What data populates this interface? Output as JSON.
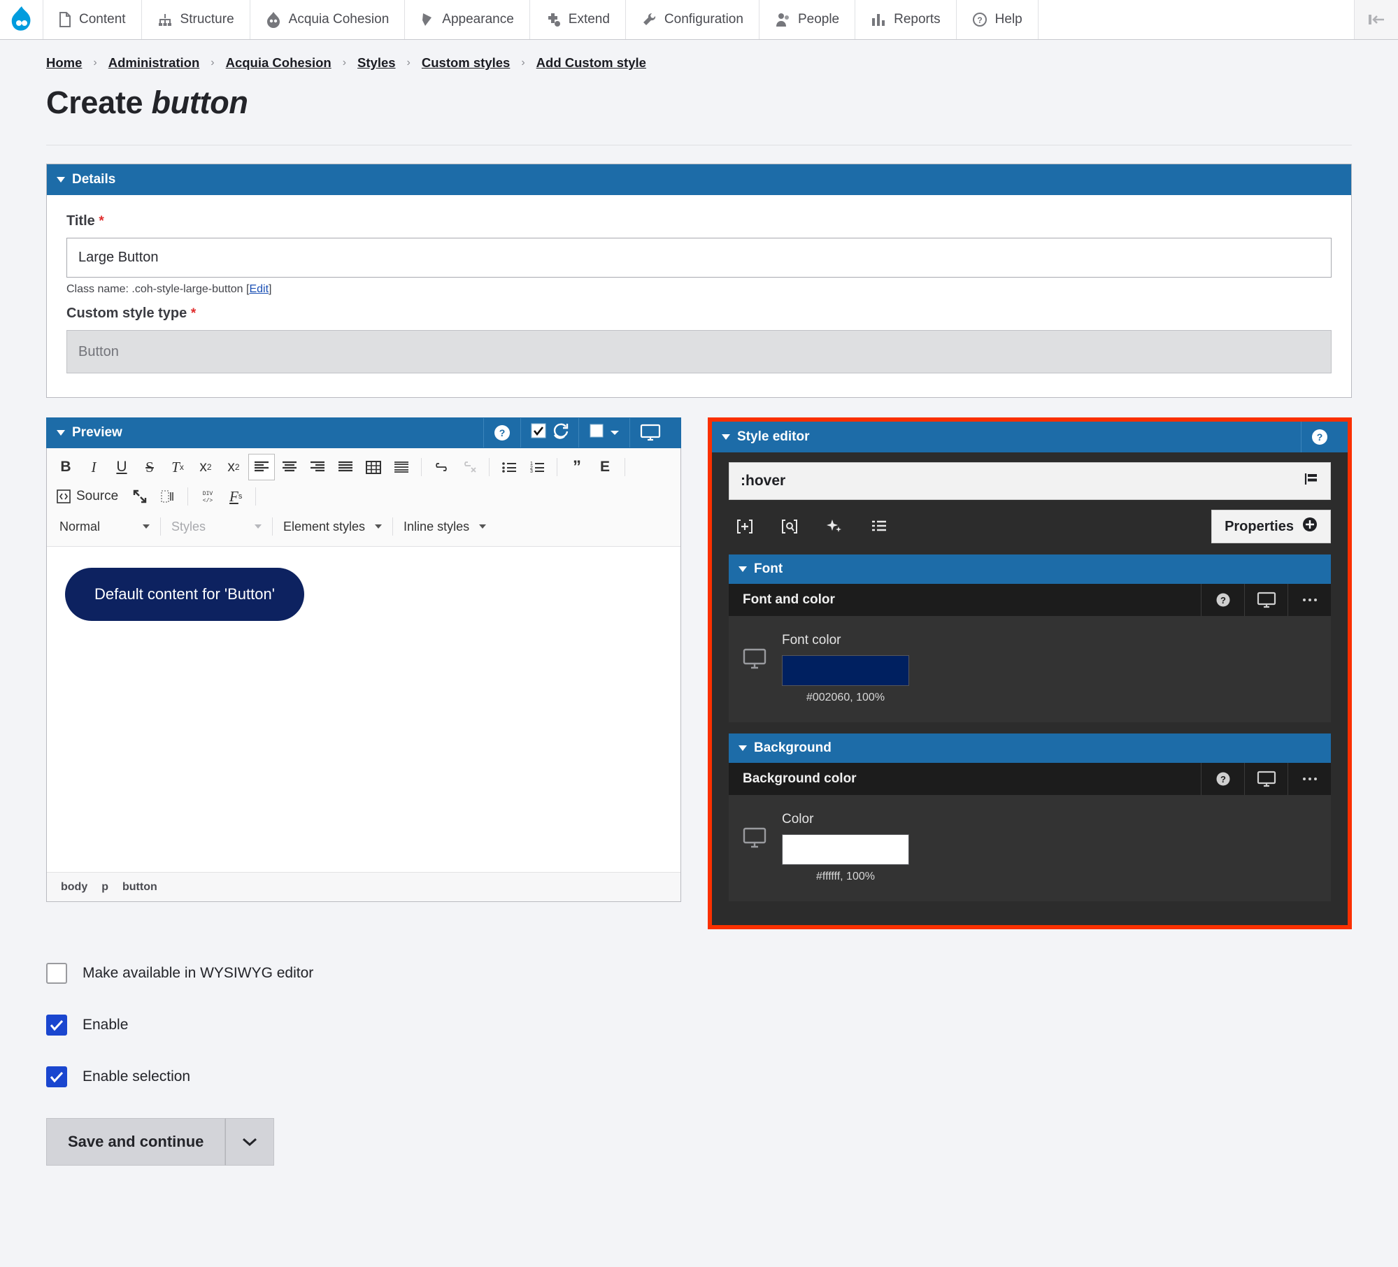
{
  "admin_toolbar": {
    "logo": "drupal-logo",
    "items": [
      {
        "label": "Content",
        "icon": "content-icon"
      },
      {
        "label": "Structure",
        "icon": "structure-icon"
      },
      {
        "label": "Acquia Cohesion",
        "icon": "acquia-cohesion-icon"
      },
      {
        "label": "Appearance",
        "icon": "appearance-icon"
      },
      {
        "label": "Extend",
        "icon": "extend-icon"
      },
      {
        "label": "Configuration",
        "icon": "configuration-icon"
      },
      {
        "label": "People",
        "icon": "people-icon"
      },
      {
        "label": "Reports",
        "icon": "reports-icon"
      },
      {
        "label": "Help",
        "icon": "help-icon"
      }
    ],
    "collapse_icon": "collapse-toolbar-icon"
  },
  "breadcrumb": [
    "Home",
    "Administration",
    "Acquia Cohesion",
    "Styles",
    "Custom styles",
    "Add Custom style"
  ],
  "page": {
    "title_prefix": "Create",
    "title_emphasis": "button"
  },
  "details": {
    "panel_title": "Details",
    "title_label": "Title",
    "title_value": "Large Button",
    "title_placeholder": "Title",
    "required_mark": "*",
    "class_name_text": "Class name: .coh-style-large-button [",
    "class_name_edit": "Edit",
    "class_name_close": "]",
    "custom_style_type_label": "Custom style type",
    "custom_style_type_value": "Button"
  },
  "preview": {
    "panel_title": "Preview",
    "actions": [
      {
        "name": "help-icon",
        "label": "?"
      },
      {
        "name": "validate-checkbox-icon",
        "label": ""
      },
      {
        "name": "refresh-icon",
        "label": ""
      },
      {
        "name": "background-color-swatch",
        "label": ""
      },
      {
        "name": "desktop-breakpoint-icon",
        "label": ""
      }
    ],
    "toolbar_row1": [
      {
        "name": "bold-icon",
        "glyph": "B",
        "state": "normal"
      },
      {
        "name": "italic-icon",
        "glyph": "I",
        "state": "normal"
      },
      {
        "name": "underline-icon",
        "glyph": "U",
        "state": "normal"
      },
      {
        "name": "strikethrough-icon",
        "glyph": "S",
        "state": "normal"
      },
      {
        "name": "remove-format-icon",
        "glyph": "Tx",
        "state": "normal"
      },
      {
        "name": "superscript-icon",
        "glyph": "x2",
        "state": "normal"
      },
      {
        "name": "subscript-icon",
        "glyph": "x2",
        "state": "normal"
      },
      {
        "name": "align-left-icon",
        "glyph": "",
        "state": "active"
      },
      {
        "name": "align-center-icon",
        "glyph": "",
        "state": "normal"
      },
      {
        "name": "align-right-icon",
        "glyph": "",
        "state": "normal"
      },
      {
        "name": "align-justify-icon",
        "glyph": "",
        "state": "normal"
      },
      {
        "name": "table-icon",
        "glyph": "",
        "state": "normal"
      },
      {
        "name": "horizontal-rule-icon",
        "glyph": "",
        "state": "normal"
      },
      {
        "name": "link-icon",
        "glyph": "",
        "state": "normal"
      },
      {
        "name": "unlink-icon",
        "glyph": "",
        "state": "disabled"
      },
      {
        "name": "bulleted-list-icon",
        "glyph": "",
        "state": "normal"
      },
      {
        "name": "numbered-list-icon",
        "glyph": "",
        "state": "normal"
      },
      {
        "name": "blockquote-icon",
        "glyph": "”",
        "state": "normal"
      },
      {
        "name": "entity-icon",
        "glyph": "E",
        "state": "normal"
      }
    ],
    "toolbar_row2": {
      "source_label": "Source",
      "buttons": [
        {
          "name": "maximize-icon"
        },
        {
          "name": "show-blocks-icon"
        },
        {
          "name": "div-container-icon"
        },
        {
          "name": "styles-format-icon"
        }
      ]
    },
    "combos": [
      {
        "name": "paragraph-format-select",
        "value": "Normal",
        "muted": false
      },
      {
        "name": "styles-select",
        "value": "Styles",
        "muted": true
      },
      {
        "name": "element-styles-select",
        "value": "Element styles",
        "muted": false
      },
      {
        "name": "inline-styles-select",
        "value": "Inline styles",
        "muted": false
      }
    ],
    "canvas_button_text": "Default content for 'Button'",
    "canvas_button_bg": "#0d2260",
    "canvas_button_color": "#ffffff",
    "element_path": [
      "body",
      "p",
      "button"
    ]
  },
  "style_editor": {
    "panel_title": "Style editor",
    "help_icon": "help-icon",
    "highlight_color": "#fa3000",
    "selector_value": ":hover",
    "selector_menu_icon": "selector-menu-icon",
    "tools": [
      {
        "name": "add-state-icon",
        "glyph": "[+]"
      },
      {
        "name": "inspect-selector-icon",
        "glyph": "[Q]"
      },
      {
        "name": "magic-styles-icon",
        "glyph": "✦"
      },
      {
        "name": "list-view-icon",
        "glyph": "☰"
      }
    ],
    "properties_button": "Properties",
    "groups": [
      {
        "name": "font-group",
        "title": "Font",
        "subsection_title": "Font and color",
        "subsection_actions": [
          "help-icon",
          "desktop-breakpoint-icon",
          "more-options-icon"
        ],
        "field_label": "Font color",
        "field_icon": "desktop-breakpoint-icon",
        "swatch_color": "#002060",
        "swatch_value": "#002060, 100%"
      },
      {
        "name": "background-group",
        "title": "Background",
        "subsection_title": "Background color",
        "subsection_actions": [
          "help-icon",
          "desktop-breakpoint-icon",
          "more-options-icon"
        ],
        "field_label": "Color",
        "field_icon": "desktop-breakpoint-icon",
        "swatch_color": "#ffffff",
        "swatch_value": "#ffffff, 100%"
      }
    ]
  },
  "options": [
    {
      "name": "make-available-wysiwyg-checkbox",
      "label": "Make available in WYSIWYG editor",
      "checked": false
    },
    {
      "name": "enable-checkbox",
      "label": "Enable",
      "checked": true
    },
    {
      "name": "enable-selection-checkbox",
      "label": "Enable selection",
      "checked": true
    }
  ],
  "actions": {
    "save_label": "Save and continue",
    "dropdown_icon": "chevron-down-icon"
  }
}
